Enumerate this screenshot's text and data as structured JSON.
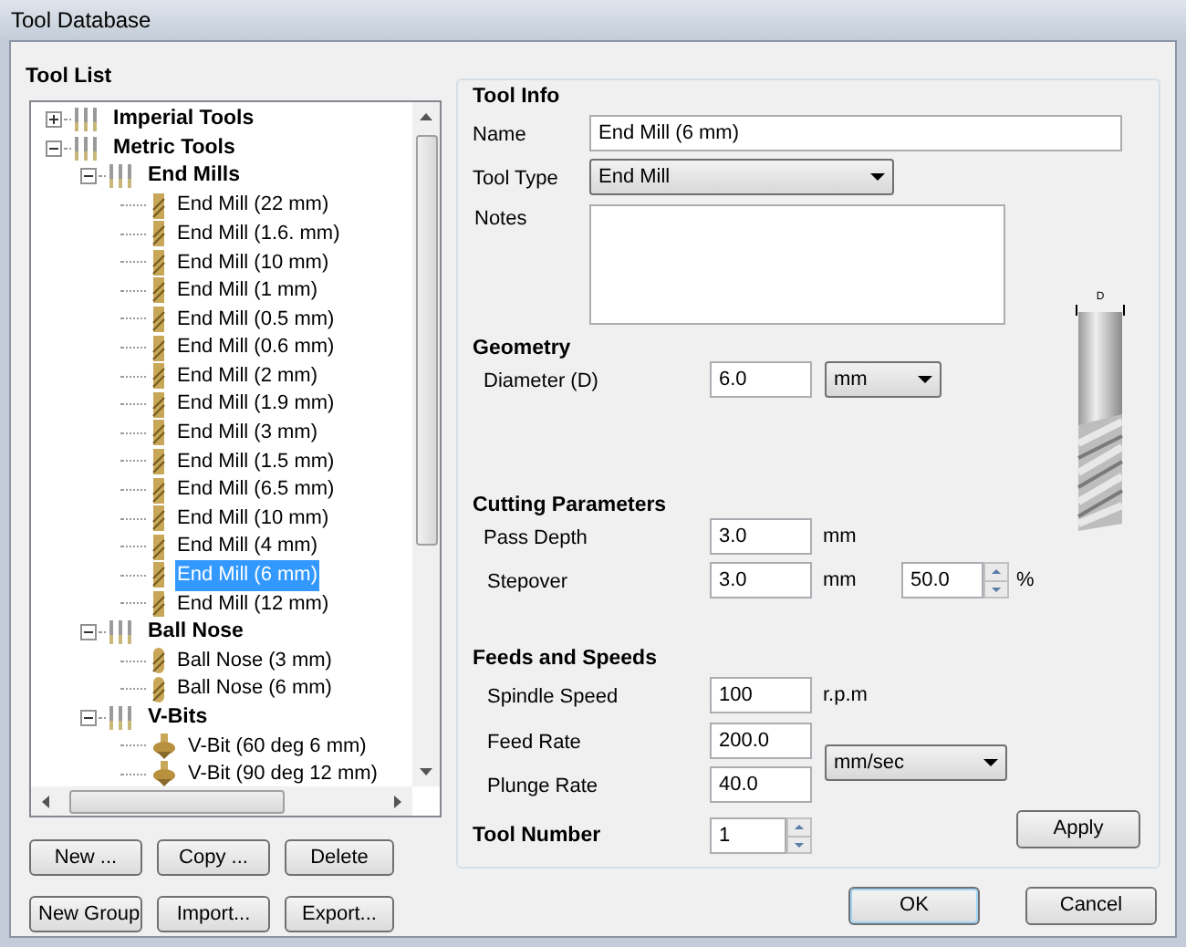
{
  "window": {
    "title": "Tool Database"
  },
  "tool_list": {
    "title": "Tool List",
    "tree": [
      {
        "kind": "group",
        "label": "Imperial Tools",
        "expanded": false,
        "selected": false
      },
      {
        "kind": "group",
        "label": "Metric Tools",
        "expanded": true,
        "selected": false,
        "children": [
          {
            "kind": "group",
            "label": "End Mills",
            "expanded": true,
            "selected": false,
            "children": [
              {
                "kind": "end_mill",
                "label": "End Mill (22 mm)",
                "selected": false
              },
              {
                "kind": "end_mill",
                "label": "End Mill (1.6. mm)",
                "selected": false
              },
              {
                "kind": "end_mill",
                "label": "End Mill (10 mm)",
                "selected": false
              },
              {
                "kind": "end_mill",
                "label": "End Mill (1 mm)",
                "selected": false
              },
              {
                "kind": "end_mill",
                "label": "End Mill (0.5 mm)",
                "selected": false
              },
              {
                "kind": "end_mill",
                "label": "End Mill (0.6 mm)",
                "selected": false
              },
              {
                "kind": "end_mill",
                "label": "End Mill (2 mm)",
                "selected": false
              },
              {
                "kind": "end_mill",
                "label": "End Mill (1.9 mm)",
                "selected": false
              },
              {
                "kind": "end_mill",
                "label": "End Mill (3 mm)",
                "selected": false
              },
              {
                "kind": "end_mill",
                "label": "End Mill (1.5 mm)",
                "selected": false
              },
              {
                "kind": "end_mill",
                "label": "End Mill (6.5 mm)",
                "selected": false
              },
              {
                "kind": "end_mill",
                "label": "End Mill (10 mm)",
                "selected": false
              },
              {
                "kind": "end_mill",
                "label": "End Mill (4 mm)",
                "selected": false
              },
              {
                "kind": "end_mill",
                "label": "End Mill (6 mm)",
                "selected": true
              },
              {
                "kind": "end_mill",
                "label": "End Mill (12 mm)",
                "selected": false
              }
            ]
          },
          {
            "kind": "group",
            "label": "Ball Nose",
            "expanded": true,
            "selected": false,
            "children": [
              {
                "kind": "ball_nose",
                "label": "Ball Nose (3 mm)",
                "selected": false
              },
              {
                "kind": "ball_nose",
                "label": "Ball Nose (6 mm)",
                "selected": false
              }
            ]
          },
          {
            "kind": "group",
            "label": "V-Bits",
            "expanded": true,
            "selected": false,
            "children": [
              {
                "kind": "v_bit",
                "label": "V-Bit (60 deg 6 mm)",
                "selected": false
              },
              {
                "kind": "v_bit",
                "label": "V-Bit (90 deg 12 mm)",
                "selected": false
              }
            ]
          }
        ]
      }
    ],
    "buttons": [
      [
        "New ...",
        "Copy ...",
        "Delete"
      ],
      [
        "New Group",
        "Import...",
        "Export..."
      ]
    ]
  },
  "tool_info": {
    "title": "Tool Info",
    "name": {
      "label": "Name",
      "value": "End Mill (6 mm)"
    },
    "tool_type": {
      "label": "Tool Type",
      "value": "End Mill"
    },
    "notes": {
      "label": "Notes"
    }
  },
  "geometry": {
    "title": "Geometry",
    "diameter": {
      "label": "Diameter (D)",
      "value": "6.0",
      "unit": "mm"
    },
    "dimension_label": "D"
  },
  "cutting_parameters": {
    "title": "Cutting Parameters",
    "pass_depth": {
      "label": "Pass Depth",
      "value": "3.0",
      "unit": "mm"
    },
    "stepover": {
      "label": "Stepover",
      "value": "3.0",
      "unit": "mm",
      "percent": "50.0",
      "percent_unit": "%"
    }
  },
  "feeds_and_speeds": {
    "title": "Feeds and Speeds",
    "spindle_speed": {
      "label": "Spindle Speed",
      "value": "100",
      "unit": "r.p.m"
    },
    "feed_rate": {
      "label": "Feed Rate",
      "value": "200.0"
    },
    "plunge_rate": {
      "label": "Plunge Rate",
      "value": "40.0"
    },
    "rate_unit": "mm/sec"
  },
  "tool_number": {
    "label": "Tool Number",
    "value": "1"
  },
  "apply": "Apply",
  "dialog_buttons": [
    {
      "label": "OK",
      "default": true
    },
    {
      "label": "Cancel",
      "default": false
    }
  ]
}
